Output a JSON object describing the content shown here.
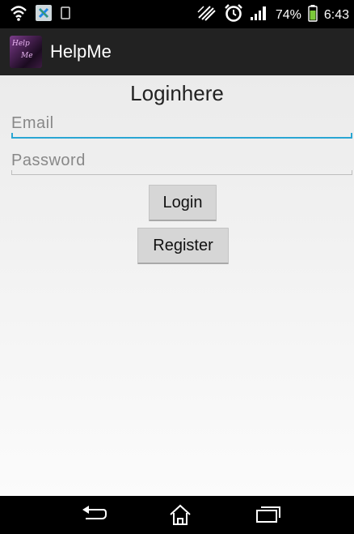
{
  "status_bar": {
    "battery_percent": "74%",
    "time": "6:43",
    "icons": [
      "wifi-icon",
      "sync-icon",
      "notification-icon",
      "vibrate-icon",
      "alarm-icon",
      "signal-icon",
      "battery-icon"
    ]
  },
  "action_bar": {
    "app_title": "HelpMe",
    "app_icon": "app-logo-icon"
  },
  "login": {
    "heading": "Loginhere",
    "email_placeholder": "Email",
    "password_placeholder": "Password",
    "login_label": "Login",
    "register_label": "Register"
  },
  "nav_bar": {
    "icons": [
      "back-icon",
      "home-icon",
      "recent-apps-icon"
    ]
  },
  "colors": {
    "status_bar": "#000000",
    "action_bar": "#222222",
    "focus_underline": "#2aa6d3",
    "button_bg": "#d6d6d6"
  }
}
